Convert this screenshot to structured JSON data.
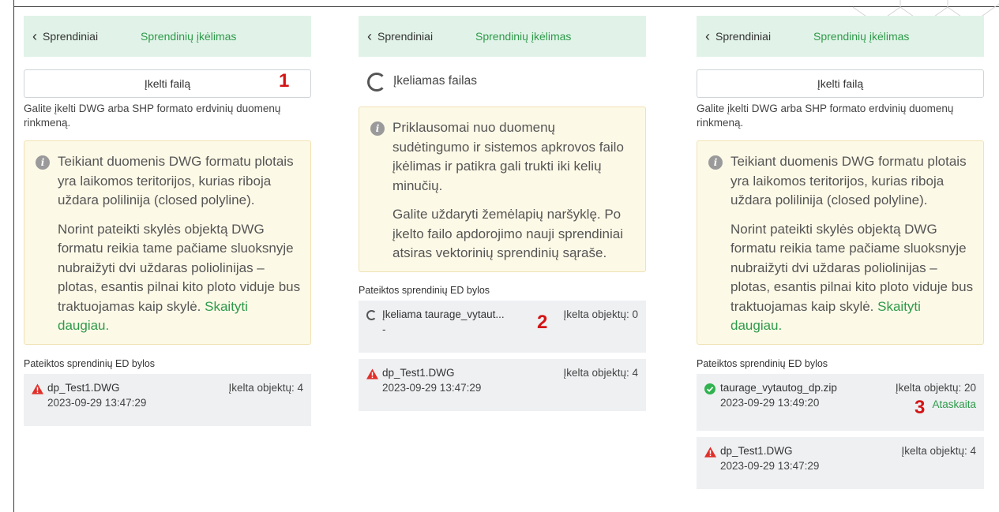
{
  "panel1": {
    "back_label": "Sprendiniai",
    "title": "Sprendinių įkėlimas",
    "upload_button": "Įkelti failą",
    "upload_hint": "Galite įkelti DWG arba SHP formato erdvinių duomenų rinkmeną.",
    "alert_p1": "Teikiant duomenis DWG formatu plotais yra laikomos teritorijos, kurias riboja uždara polilinija (closed polyline).",
    "alert_p2": "Norint pateikti skylės objektą DWG formatu reikia tame pačiame sluoksnyje nubraižyti dvi uždaras poliolinijas – plotas, esantis pilnai kito ploto viduje bus traktuojamas kaip skylė.",
    "alert_link": "Skaityti daugiau.",
    "section_title": "Pateiktos sprendinių ED bylos",
    "files": [
      {
        "name": "dp_Test1.DWG",
        "date": "2023-09-29 13:47:29",
        "count": "Įkelta objektų: 4",
        "status": "error"
      }
    ],
    "marker": "1"
  },
  "panel2": {
    "back_label": "Sprendiniai",
    "title": "Sprendinių įkėlimas",
    "loading_text": "Įkeliamas failas",
    "alert_p1": "Priklausomai nuo duomenų sudėtingumo ir sistemos apkrovos failo įkėlimas ir patikra gali trukti iki kelių minučių.",
    "alert_p2": "Galite uždaryti žemėlapių naršyklę. Po įkelto failo apdorojimo nauji sprendiniai atsiras vektorinių sprendinių sąraše.",
    "section_title": "Pateiktos sprendinių ED bylos",
    "uploading": {
      "prefix": "Įkeliama",
      "name": "taurage_vytaut...",
      "date": "-",
      "count": "Įkelta objektų: 0"
    },
    "files": [
      {
        "name": "dp_Test1.DWG",
        "date": "2023-09-29 13:47:29",
        "count": "Įkelta objektų: 4",
        "status": "error"
      }
    ],
    "marker": "2"
  },
  "panel3": {
    "back_label": "Sprendiniai",
    "title": "Sprendinių įkėlimas",
    "upload_button": "Įkelti failą",
    "upload_hint": "Galite įkelti DWG arba SHP formato erdvinių duomenų rinkmeną.",
    "alert_p1": "Teikiant duomenis DWG formatu plotais yra laikomos teritorijos, kurias riboja uždara polilinija (closed polyline).",
    "alert_p2": "Norint pateikti skylės objektą DWG formatu reikia tame pačiame sluoksnyje nubraižyti dvi uždaras poliolinijas – plotas, esantis pilnai kito ploto viduje bus traktuojamas kaip skylė.",
    "alert_link": "Skaityti daugiau.",
    "section_title": "Pateiktos sprendinių ED bylos",
    "files": [
      {
        "name": "taurage_vytautog_dp.zip",
        "date": "2023-09-29 13:49:20",
        "count": "Įkelta objektų: 20",
        "status": "success",
        "report": "Ataskaita"
      },
      {
        "name": "dp_Test1.DWG",
        "date": "2023-09-29 13:47:29",
        "count": "Įkelta objektų: 4",
        "status": "error"
      }
    ],
    "marker": "3"
  },
  "colors": {
    "accent_green": "#2e9a4a",
    "header_bg": "#e1f3e8",
    "alert_bg": "#fdf9e7",
    "error_red": "#e0302a",
    "success_green": "#2fb24f"
  }
}
